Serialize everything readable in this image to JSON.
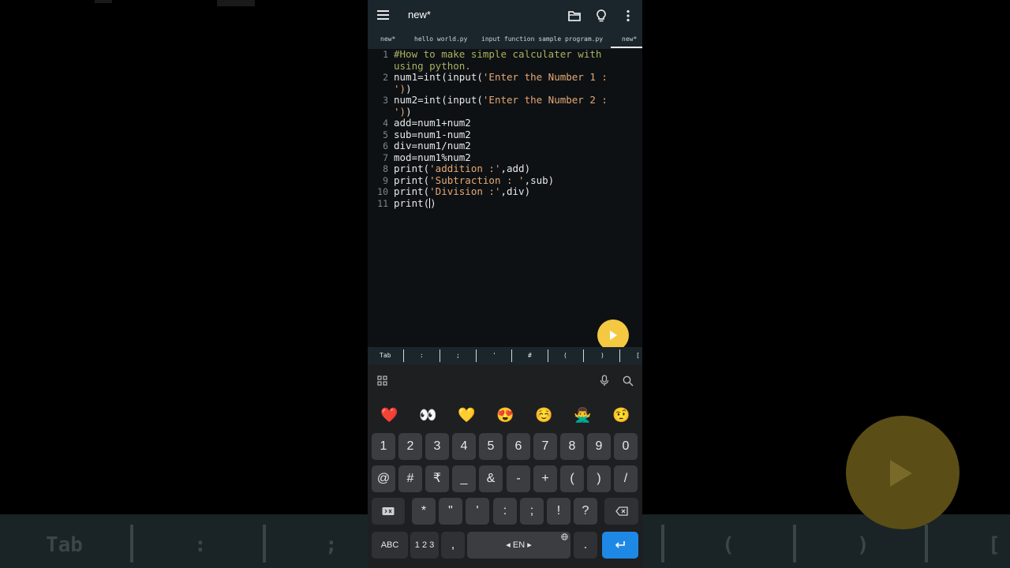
{
  "app": {
    "title": "new*"
  },
  "tabs": [
    {
      "label": "new*"
    },
    {
      "label": "hello world.py"
    },
    {
      "label": "input function sample program.py"
    },
    {
      "label": "new*"
    }
  ],
  "code": {
    "line_numbers": [
      "1",
      "2",
      "3",
      "4",
      "5",
      "6",
      "7",
      "8",
      "9",
      "10",
      "11"
    ],
    "lines": [
      {
        "comment": "#How to make simple calculater with"
      },
      {
        "comment": "using python."
      },
      {
        "code": "num1=int(input(",
        "string": "'Enter the Number 1 :"
      },
      {
        "string": "')",
        "code": ")"
      },
      {
        "code": "num2=int(input(",
        "string": "'Enter the Number 2 :"
      },
      {
        "string": "')",
        "code": ")"
      },
      {
        "code": "add=num1+num2"
      },
      {
        "code": "sub=num1-num2"
      },
      {
        "code": "div=num1/num2"
      },
      {
        "code": "mod=num1%num2"
      },
      {
        "code_a": "print(",
        "string": "'addition :'",
        "code_b": ",add)"
      },
      {
        "code_a": "print(",
        "string": "'Subtraction : '",
        "code_b": ",sub)"
      },
      {
        "code_a": "print(",
        "string": "'Division :'",
        "code_b": ",div)"
      },
      {
        "code_a": "print(",
        "code_b": ")"
      }
    ]
  },
  "symbol_bar": [
    "Tab",
    ":",
    ";",
    "'",
    "#",
    "(",
    ")",
    "["
  ],
  "keyboard": {
    "emoji": [
      "❤️",
      "👀",
      "💛",
      "😍",
      "☺️",
      "🙅‍♂️",
      "🤨"
    ],
    "row_numbers": [
      "1",
      "2",
      "3",
      "4",
      "5",
      "6",
      "7",
      "8",
      "9",
      "0"
    ],
    "row_symbols": [
      "@",
      "#",
      "₹",
      "_",
      "&",
      "-",
      "+",
      "(",
      ")",
      "/"
    ],
    "row_three": [
      "*",
      "\"",
      "'",
      ":",
      ";",
      "!",
      "?"
    ],
    "abc": "ABC",
    "num": "1 2 3",
    "comma": ",",
    "space": "◂ EN ▸",
    "period": "."
  },
  "background": {
    "tab": "Tab",
    "colon": ":",
    "semicolon": ";",
    "lparen": "(",
    "rparen": ")",
    "lbracket": "["
  },
  "colors": {
    "accent": "#f5c842",
    "enter_key": "#1e88e5",
    "string": "#e6a873",
    "comment": "#a9b15f"
  }
}
